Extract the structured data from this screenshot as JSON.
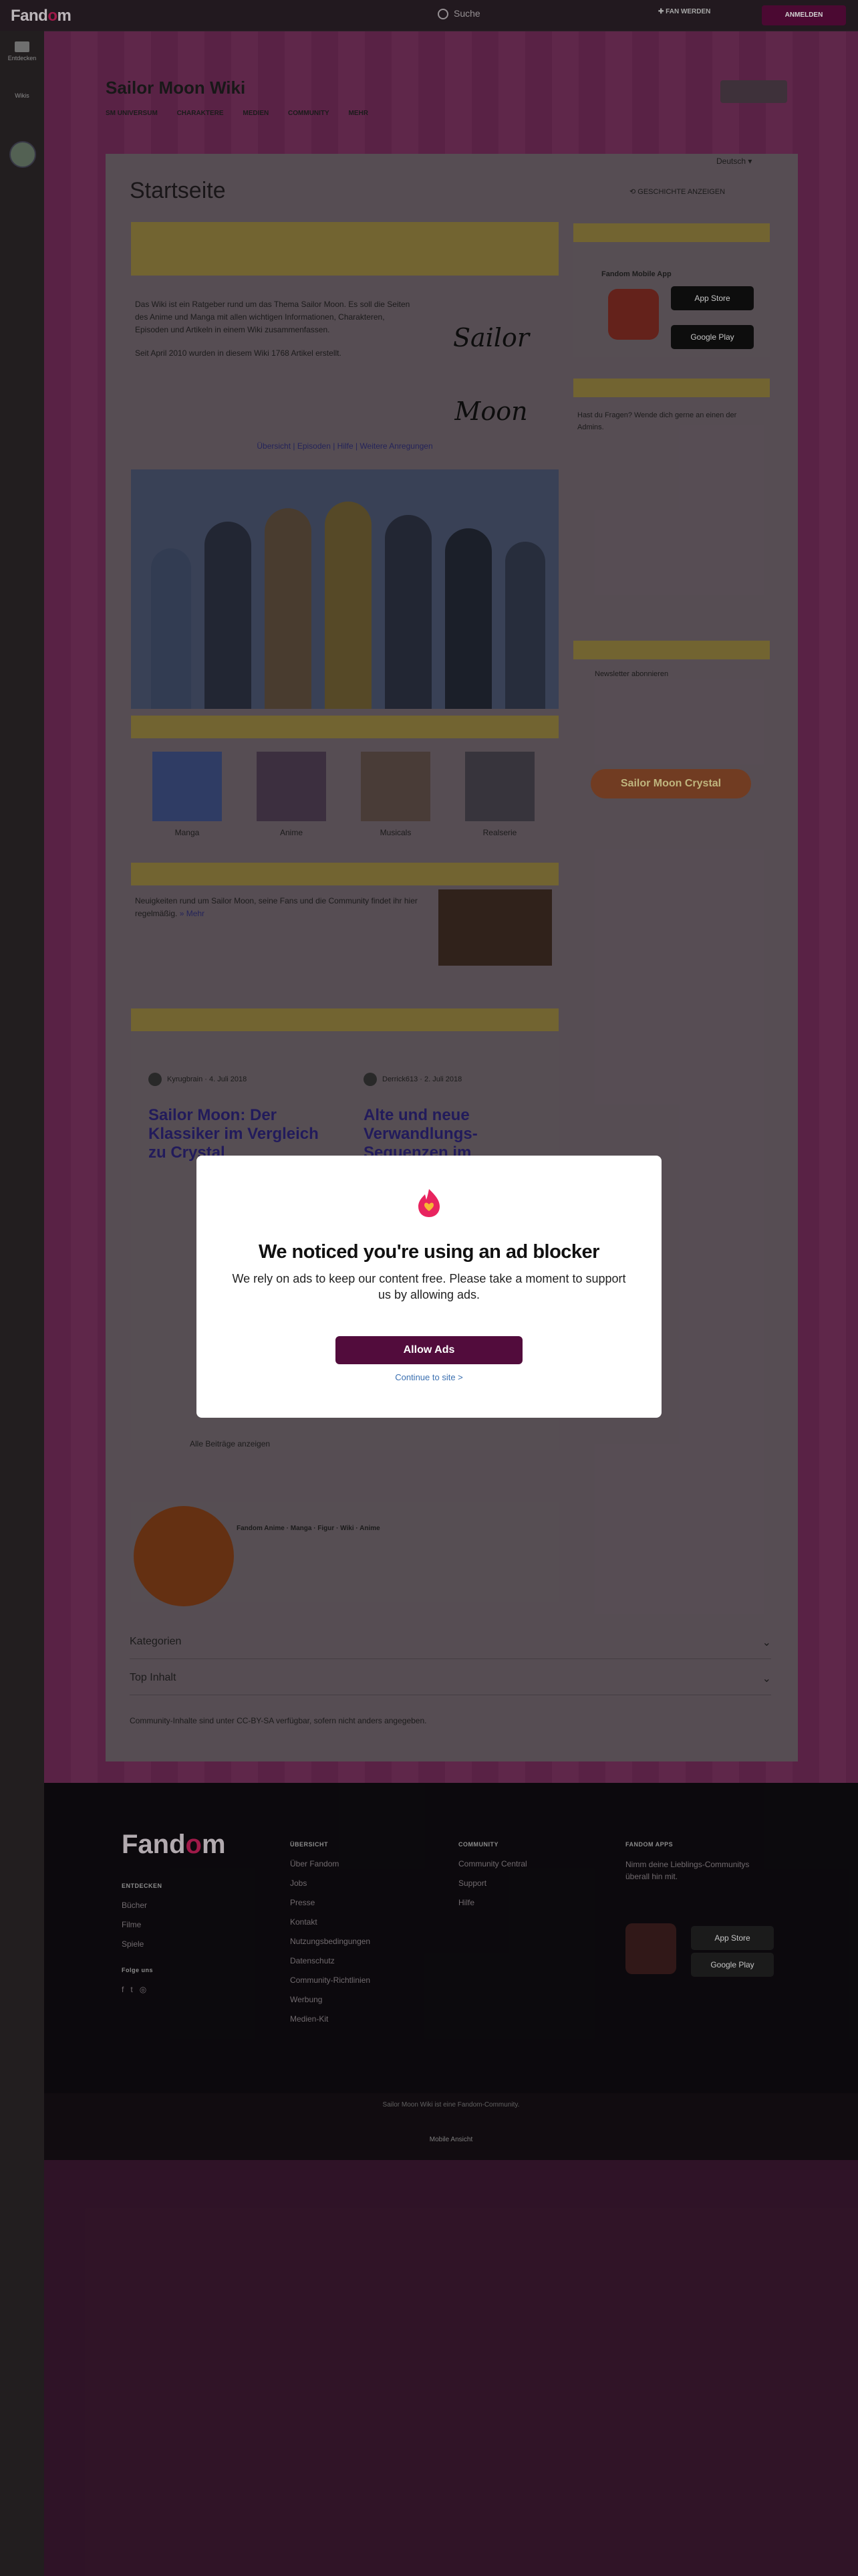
{
  "topbar": {
    "logo_pre": "Fand",
    "logo_o": "o",
    "logo_post": "m",
    "search_placeholder": "Suche",
    "fan_button": "FAN WERDEN",
    "register_button": "ANMELDEN"
  },
  "leftrail": {
    "item1": "Entdecken",
    "item2": "Wikis"
  },
  "wiki": {
    "name": "Sailor Moon Wiki",
    "nav": [
      "SM UNIVERSUM",
      "CHARAKTERE",
      "MEDIEN",
      "COMMUNITY",
      "MEHR"
    ]
  },
  "article": {
    "title": "Startseite",
    "language": "Deutsch",
    "history_button": "GESCHICHTE ANZEIGEN",
    "intro_p1": "Das Wiki ist ein Ratgeber rund um das Thema Sailor Moon. Es soll die Seiten des Anime und Manga mit allen wichtigen Informationen, Charakteren, Episoden und Artikeln in einem Wiki zusammenfassen.",
    "intro_p2": "Seit April 2010 wurden in diesem Wiki 1768 Artikel erstellt.",
    "links_line": "Übersicht | Episoden | Hilfe | Weitere Anregungen",
    "logo_text": "Sailor Moon",
    "thumbs": [
      "Manga",
      "Anime",
      "Musicals",
      "Realserie"
    ],
    "news_text": "Neuigkeiten rund um Sailor Moon, seine Fans und die Community findet ihr hier regelmäßig.",
    "more_link": "» Mehr",
    "blog_author1": "Kyrugbrain",
    "blog_date1": "4. Juli 2018",
    "blog_title1": "Sailor Moon: Der Klassiker im Vergleich zu Crystal",
    "blog_author2": "Derrick613",
    "blog_date2": "2. Juli 2018",
    "blog_title2": "Alte und neue Verwandlungs-Sequenzen im Vergleich",
    "see_more": "Alle Beiträge anzeigen",
    "community_line": "Fandom Anime · Manga · Figur · Wiki · Anime",
    "categories": "Kategorien",
    "top_lists": "Top Inhalt",
    "license": "Community-Inhalte sind unter CC-BY-SA verfügbar, sofern nicht anders angegeben."
  },
  "sidebar": {
    "app_heading": "Fandom Mobile App",
    "app_store": "App Store",
    "google_play": "Google Play",
    "box2_text": "Hast du Fragen? Wende dich gerne an einen der Admins.",
    "box3_text": "Newsletter abonnieren",
    "brand": "Sailor Moon Crystal"
  },
  "modal": {
    "heading": "We noticed you're using an ad blocker",
    "text": "We rely on ads to keep our content free. Please take a moment to support us by allowing ads.",
    "allow_button": "Allow Ads",
    "continue_link": "Continue to site >"
  },
  "footer": {
    "logo_pre": "Fand",
    "logo_o": "o",
    "logo_post": "m",
    "col1_head": "ENTDECKEN",
    "col1": [
      "Bücher",
      "Filme",
      "Spiele"
    ],
    "col2_head": "ÜBERSICHT",
    "col2": [
      "Über Fandom",
      "Jobs",
      "Presse",
      "Kontakt",
      "Nutzungsbedingungen",
      "Datenschutz",
      "Community-Richtlinien",
      "Werbung",
      "Medien-Kit"
    ],
    "col3_head": "COMMUNITY",
    "col3": [
      "Community Central",
      "Support",
      "Hilfe"
    ],
    "col4_head": "FANDOM APPS",
    "col4_text": "Nimm deine Lieblings-Communitys überall hin mit.",
    "follow": "Folge uns",
    "bottom_text": "Sailor Moon Wiki ist eine Fandom-Community.",
    "bottom_link": "Mobile Ansicht"
  }
}
